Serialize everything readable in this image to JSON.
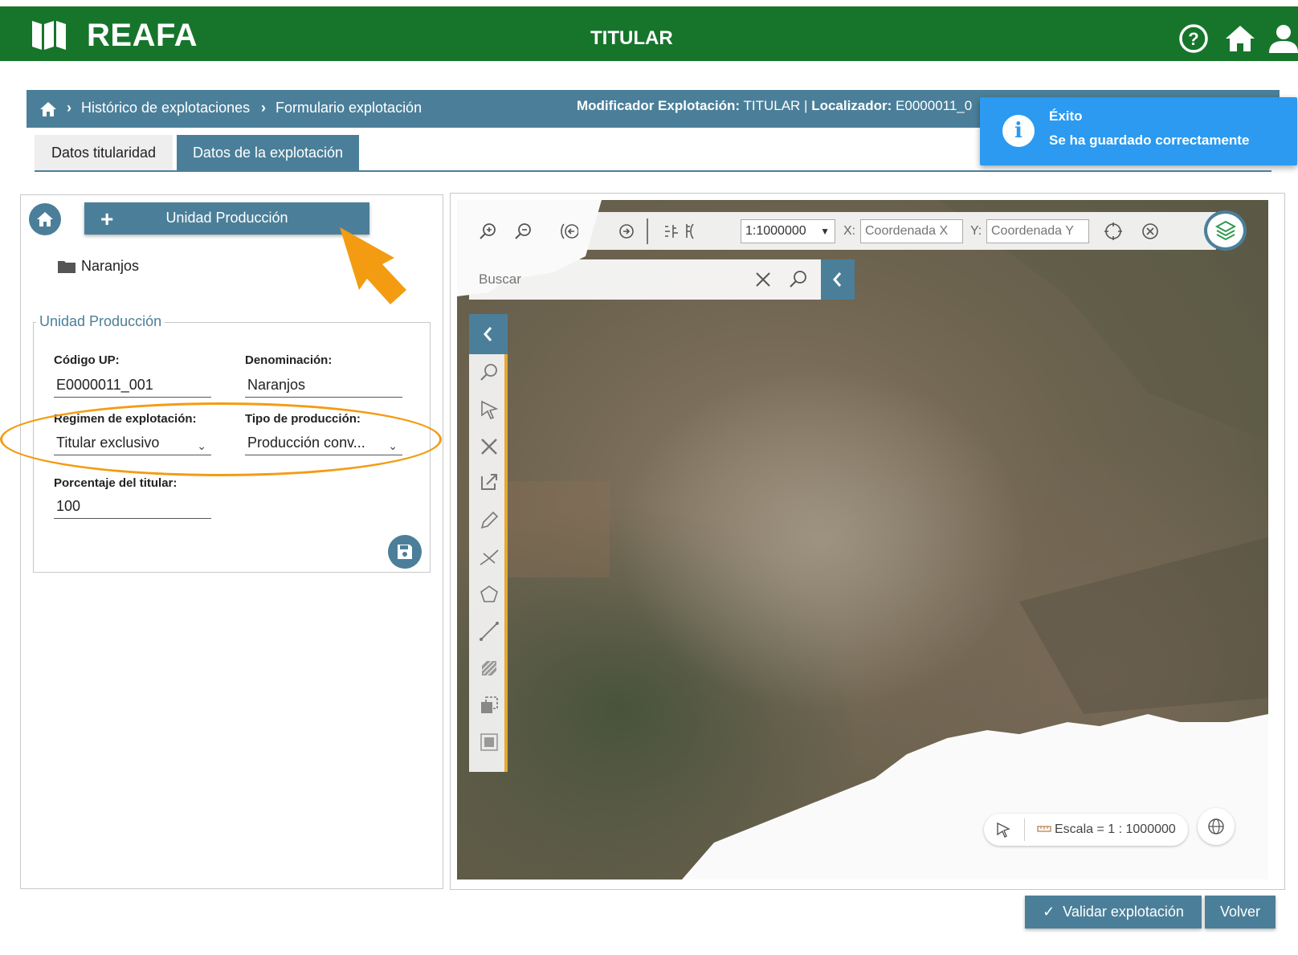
{
  "header": {
    "app_name": "REAFA",
    "role_title": "TITULAR",
    "brand_color": "#16752b",
    "icons": [
      "help-icon",
      "home-icon",
      "user-icon"
    ]
  },
  "breadcrumb": {
    "items": [
      "Histórico de explotaciones",
      "Formulario explotación"
    ],
    "meta_modificador_label": "Modificador Explotación:",
    "meta_modificador_value": " TITULAR | ",
    "meta_localizador_label": "Localizador:",
    "meta_localizador_value": " E0000011_0"
  },
  "toast": {
    "title": "Éxito",
    "message": "Se ha guardado correctamente",
    "color": "#2b9af0"
  },
  "tabs": [
    {
      "label": "Datos titularidad",
      "active": false
    },
    {
      "label": "Datos de la explotación",
      "active": true
    }
  ],
  "left_panel": {
    "add_button_label": "Unidad Producción",
    "tree_item": "Naranjos",
    "section_legend": "Unidad Producción",
    "fields": {
      "codigo_label": "Código UP:",
      "codigo_value": "E0000011_001",
      "denominacion_label": "Denominación:",
      "denominacion_value": "Naranjos",
      "regimen_label": "Regimen de explotación:",
      "regimen_value": "Titular exclusivo",
      "tipo_label": "Tipo de producción:",
      "tipo_value": "Producción conv...",
      "porcentaje_label": "Porcentaje del titular:",
      "porcentaje_value": "100"
    }
  },
  "map": {
    "scale_select": "1:1000000",
    "coord_x_label": "X:",
    "coord_x_placeholder": "Coordenada X",
    "coord_y_label": "Y:",
    "coord_y_placeholder": "Coordenada Y",
    "search_placeholder": "Buscar",
    "scale_text": "Escala = 1 : 1000000"
  },
  "footer": {
    "validate_label": "Validar explotación",
    "back_label": "Volver"
  },
  "accent_color": "#4b7f99",
  "highlight_color": "#f39c12"
}
